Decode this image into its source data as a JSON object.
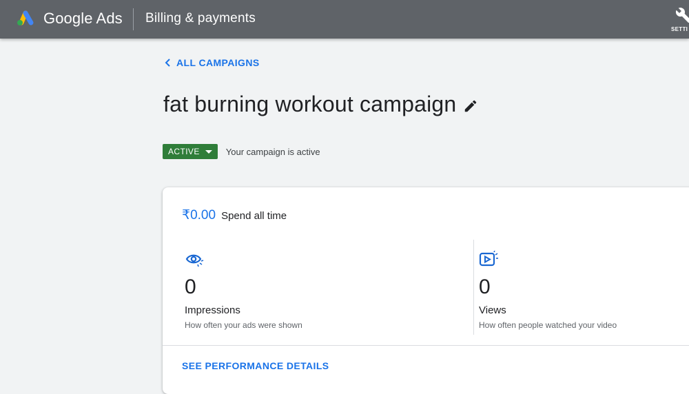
{
  "header": {
    "brand": "Google Ads",
    "page": "Billing & payments",
    "settings_label": "SETTI",
    "colors": {
      "bar": "#5f6368",
      "logo_blue": "#4285f4",
      "logo_yellow": "#fbbc04",
      "logo_green": "#34a853"
    }
  },
  "nav": {
    "back_label": "ALL CAMPAIGNS"
  },
  "campaign": {
    "title": "fat burning workout campaign",
    "status": "ACTIVE",
    "status_text": "Your campaign is active",
    "status_color": "#2f7d39"
  },
  "summary": {
    "spend_amount": "₹0.00",
    "spend_label": "Spend all time",
    "metrics": [
      {
        "icon": "eye-icon",
        "value": "0",
        "label": "Impressions",
        "desc": "How often your ads were shown"
      },
      {
        "icon": "video-play-icon",
        "value": "0",
        "label": "Views",
        "desc": "How often people watched your video"
      }
    ],
    "details_link": "SEE PERFORMANCE DETAILS"
  }
}
